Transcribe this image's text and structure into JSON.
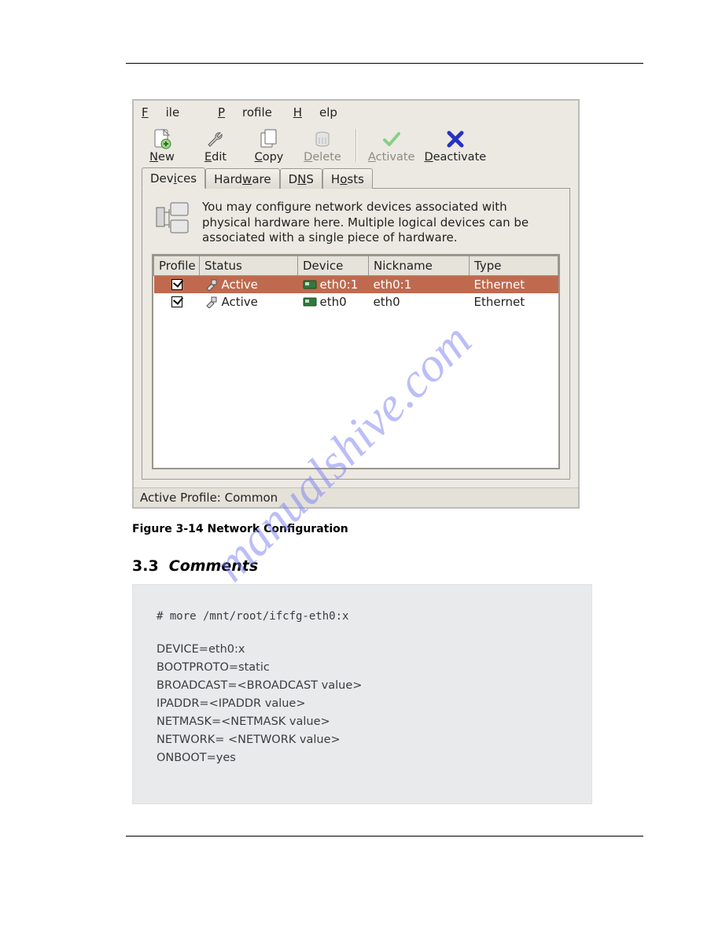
{
  "menubar": {
    "file": "File",
    "profile": "Profile",
    "help": "Help"
  },
  "toolbar": {
    "new": "New",
    "edit": "Edit",
    "copy": "Copy",
    "delete": "Delete",
    "activate": "Activate",
    "deactivate": "Deactivate"
  },
  "tabs": {
    "devices": "Devices",
    "hardware": "Hardware",
    "dns": "DNS",
    "hosts": "Hosts"
  },
  "info_text": "You may configure network devices associated with physical hardware here.  Multiple logical devices can be associated with a single piece of hardware.",
  "table": {
    "headers": {
      "profile": "Profile",
      "status": "Status",
      "device": "Device",
      "nickname": "Nickname",
      "type": "Type"
    },
    "rows": [
      {
        "status": "Active",
        "device": "eth0:1",
        "nickname": "eth0:1",
        "type": "Ethernet",
        "selected": true
      },
      {
        "status": "Active",
        "device": "eth0",
        "nickname": "eth0",
        "type": "Ethernet",
        "selected": false
      }
    ]
  },
  "statusbar": "Active Profile: Common",
  "figure_label": "Figure 3-14  Network Configuration",
  "section": {
    "number": "3.3",
    "title": "Comments"
  },
  "comment": {
    "header": "# more /mnt/root/ifcfg-eth0:x",
    "lines": [
      "DEVICE=eth0:x",
      "BOOTPROTO=static",
      "BROADCAST=<BROADCAST value>",
      "IPADDR=<IPADDR value>",
      "NETMASK=<NETMASK value>",
      "NETWORK= <NETWORK value>",
      "ONBOOT=yes"
    ]
  },
  "watermark_text": "manualshive.com"
}
